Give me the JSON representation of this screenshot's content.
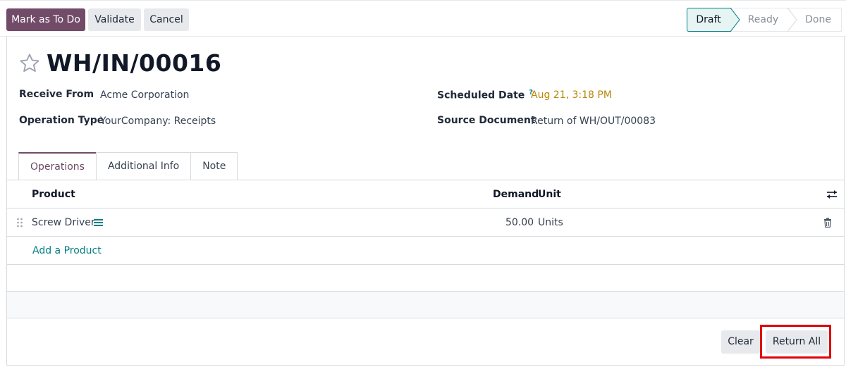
{
  "toolbar": {
    "mark_todo": "Mark as To Do",
    "validate": "Validate",
    "cancel": "Cancel"
  },
  "status": {
    "stages": [
      "Draft",
      "Ready",
      "Done"
    ],
    "active": "Draft"
  },
  "record": {
    "title": "WH/IN/00016",
    "receive_from_label": "Receive From",
    "receive_from": "Acme Corporation",
    "operation_type_label": "Operation Type",
    "operation_type": "YourCompany: Receipts",
    "scheduled_date_label": "Scheduled Date",
    "help_mark": "?",
    "scheduled_date": "Aug 21, 3:18 PM",
    "source_document_label": "Source Document",
    "source_document": "Return of WH/OUT/00083"
  },
  "tabs": [
    "Operations",
    "Additional Info",
    "Note"
  ],
  "table": {
    "headers": {
      "product": "Product",
      "demand": "Demand",
      "unit": "Unit"
    },
    "rows": [
      {
        "product": "Screw Driver",
        "demand": "50.00",
        "unit": "Units"
      }
    ],
    "add_product": "Add a Product"
  },
  "actions": {
    "clear": "Clear",
    "return_all": "Return All"
  },
  "colors": {
    "primary": "#714b67",
    "accent": "#017e84",
    "date": "#b8860b",
    "highlight": "#e0000a"
  }
}
